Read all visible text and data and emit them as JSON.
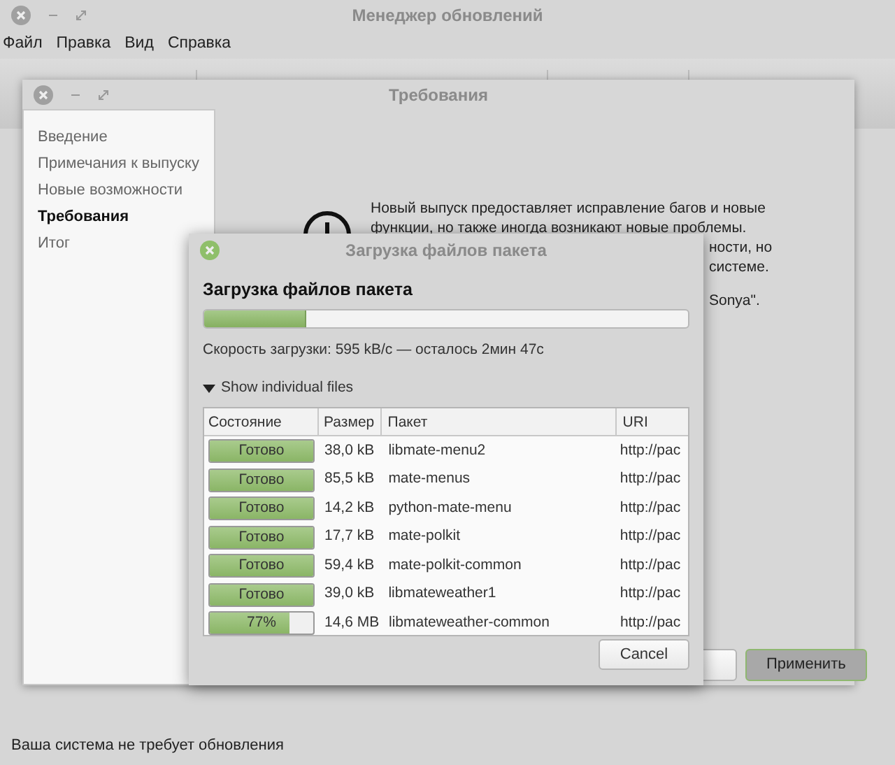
{
  "main_window": {
    "title": "Менеджер обновлений",
    "menu": [
      "Файл",
      "Правка",
      "Вид",
      "Справка"
    ],
    "status_bar": "Ваша система не требует обновления"
  },
  "wizard": {
    "title": "Требования",
    "sidebar": [
      {
        "label": "Введение",
        "selected": false
      },
      {
        "label": "Примечания к выпуску",
        "selected": false
      },
      {
        "label": "Новые возможности",
        "selected": false
      },
      {
        "label": "Требования",
        "selected": true
      },
      {
        "label": "Итог",
        "selected": false
      }
    ],
    "text_lines": [
      "Новый выпуск предоставляет исправление багов и новые",
      "функции, но также иногда возникают новые проблемы.",
      "ности, но",
      "системе.",
      "Sonya\"."
    ],
    "buttons": [
      {
        "kind": "normal"
      },
      {
        "label": "Применить",
        "kind": "default"
      }
    ]
  },
  "dialog": {
    "title": "Загрузка файлов пакета",
    "heading": "Загрузка файлов пакета",
    "level": 0.21,
    "speed": "Скорость загрузки: 595 kB/с — осталось 2мин 47с",
    "expander": {
      "label": "Show individual files",
      "expanded": true
    },
    "columns": [
      "Состояние",
      "Размер",
      "Пакет",
      "URI"
    ],
    "rows": [
      {
        "status": "Готово",
        "level": 1,
        "size": "38,0 kB",
        "package": "libmate-menu2",
        "uri": "http://pac"
      },
      {
        "status": "Готово",
        "level": 1,
        "size": "85,5 kB",
        "package": "mate-menus",
        "uri": "http://pac"
      },
      {
        "status": "Готово",
        "level": 1,
        "size": "14,2 kB",
        "package": "python-mate-menu",
        "uri": "http://pac"
      },
      {
        "status": "Готово",
        "level": 1,
        "size": "17,7 kB",
        "package": "mate-polkit",
        "uri": "http://pac"
      },
      {
        "status": "Готово",
        "level": 1,
        "size": "59,4 kB",
        "package": "mate-polkit-common",
        "uri": "http://pac"
      },
      {
        "status": "Готово",
        "level": 1,
        "size": "39,0 kB",
        "package": "libmateweather1",
        "uri": "http://pac"
      },
      {
        "status": "77%",
        "level": 0.77,
        "size": "14,6 MB",
        "package": "libmateweather-common",
        "uri": "http://pac"
      }
    ],
    "cancel": "Cancel"
  }
}
